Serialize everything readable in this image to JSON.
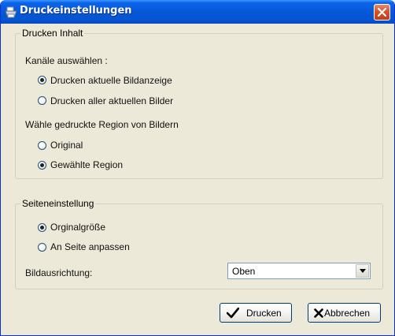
{
  "window": {
    "title": "Druckeinstellungen"
  },
  "print_content": {
    "legend": "Drucken Inhalt",
    "channels_label": "Kanäle auswählen :",
    "channel_options": [
      {
        "label": "Drucken aktuelle Bildanzeige",
        "selected": true
      },
      {
        "label": "Drucken aller aktuellen Bilder",
        "selected": false
      }
    ],
    "region_label": "Wähle gedruckte Region von Bildern",
    "region_options": [
      {
        "label": "Original",
        "selected": false
      },
      {
        "label": "Gewählte Region",
        "selected": true
      }
    ]
  },
  "page_setup": {
    "legend": "Seiteneinstellung",
    "size_options": [
      {
        "label": "Orginalgröße",
        "selected": true
      },
      {
        "label": "An Seite anpassen",
        "selected": false
      }
    ],
    "orientation_label": "Bildausrichtung:",
    "orientation_value": "Oben"
  },
  "buttons": {
    "print": "Drucken",
    "cancel": "Abbrechen"
  },
  "colors": {
    "titlebar": "#0758d8",
    "dialog_bg": "#ece9d8"
  }
}
